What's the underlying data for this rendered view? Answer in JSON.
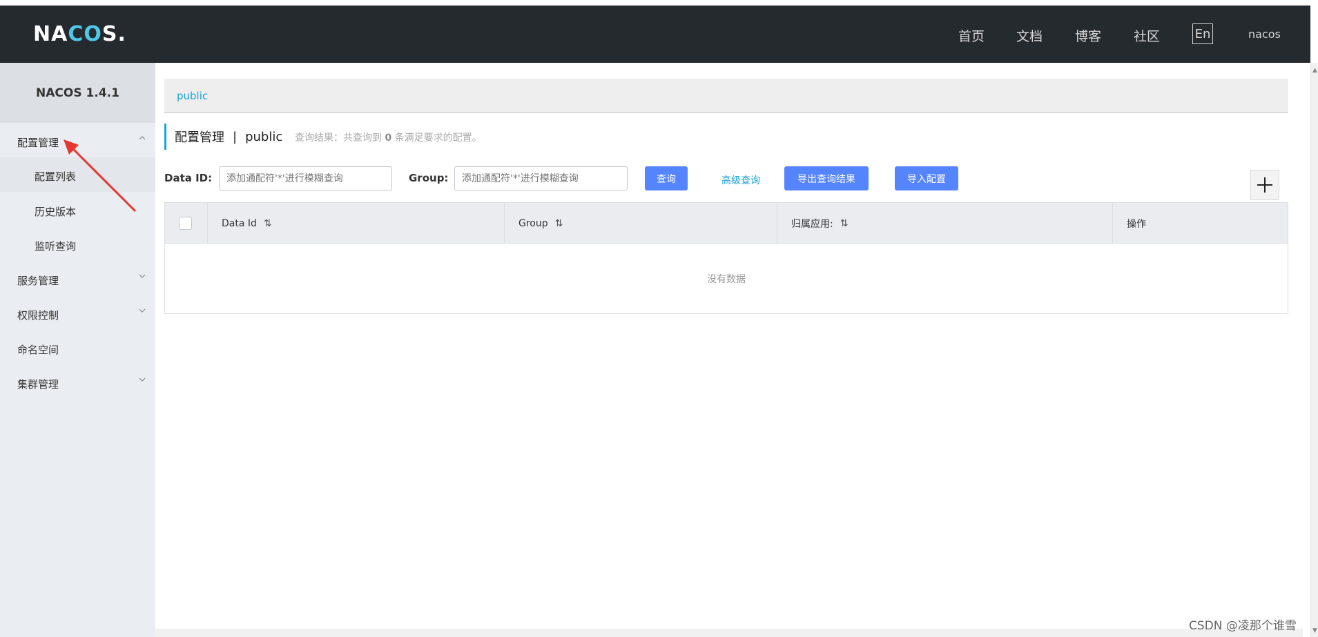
{
  "header": {
    "logo_pre": "NA",
    "logo_accent": "CO",
    "logo_post": "S.",
    "nav": [
      "首页",
      "文档",
      "博客",
      "社区"
    ],
    "lang": "En",
    "user": "nacos"
  },
  "sidebar": {
    "version": "NACOS 1.4.1",
    "menus": [
      {
        "label": "配置管理",
        "expanded": true
      },
      {
        "label": "服务管理"
      },
      {
        "label": "权限控制"
      },
      {
        "label": "命名空间"
      },
      {
        "label": "集群管理"
      }
    ],
    "submenus": [
      "配置列表",
      "历史版本",
      "监听查询"
    ]
  },
  "main": {
    "namespace_tag": "public",
    "title": "配置管理",
    "title_sep": "|",
    "title_ns": "public",
    "query_result_prefix": "查询结果：共查询到",
    "query_result_count": "0",
    "query_result_suffix": "条满足要求的配置。",
    "search": {
      "data_id_label": "Data ID:",
      "data_id_placeholder": "添加通配符'*'进行模糊查询",
      "group_label": "Group:",
      "group_placeholder": "添加通配符'*'进行模糊查询",
      "query_button": "查询",
      "advanced_query": "高级查询",
      "export_button": "导出查询结果",
      "import_button": "导入配置",
      "add_icon": "plus-icon"
    },
    "table": {
      "columns": [
        "Data Id",
        "Group",
        "归属应用:",
        "操作"
      ],
      "empty_text": "没有数据"
    }
  },
  "watermark": "CSDN @凌那个谁雪",
  "colors": {
    "header_bg": "#252a2f",
    "accent": "#1aa3d6",
    "button": "#5584ff",
    "sidebar_bg": "#eaedf1"
  }
}
